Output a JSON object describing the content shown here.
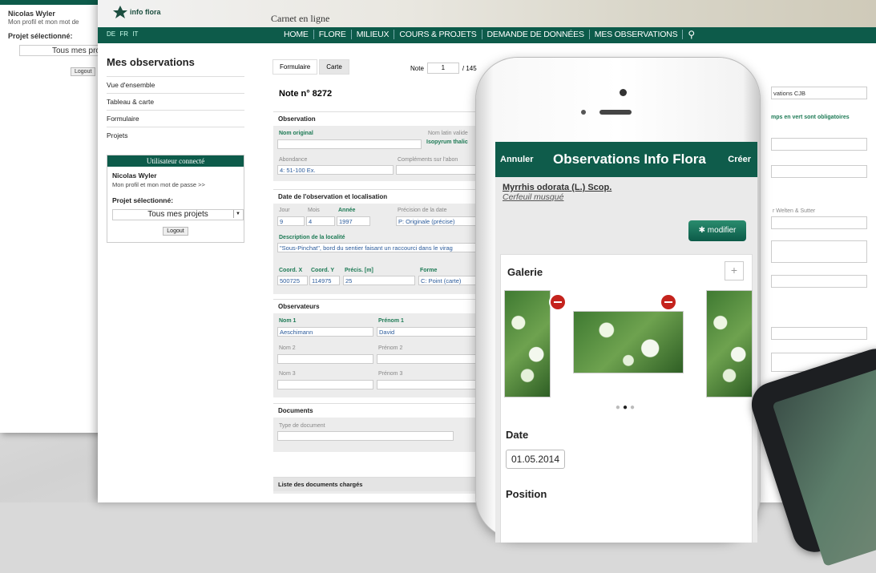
{
  "back_window": {
    "user_name": "Nicolas Wyler",
    "profile_link": "Mon profil et mon mot de",
    "project_label": "Projet sélectionné:",
    "project_value": "Tous mes pro",
    "logout": "Logout"
  },
  "header": {
    "logo_text": "info flora",
    "carnet": "Carnet en ligne",
    "languages": "DE  FR  IT",
    "menu": [
      "HOME",
      "FLORE",
      "MILIEUX",
      "COURS & PROJETS",
      "DEMANDE DE DONNÉES",
      "MES OBSERVATIONS"
    ]
  },
  "sidebar": {
    "title": "Mes observations",
    "items": [
      "Vue d'ensemble",
      "Tableau & carte",
      "Formulaire",
      "Projets"
    ],
    "user_box": {
      "title": "Utilisateur connecté",
      "name": "Nicolas Wyler",
      "profile": "Mon profil et mon mot de passe >>",
      "project_label": "Projet sélectionné:",
      "project_value": "Tous mes projets",
      "logout": "Logout"
    }
  },
  "form": {
    "tabs": [
      "Formulaire",
      "Carte"
    ],
    "note_label": "Note",
    "note_current": "1",
    "note_total": "/ 145",
    "note_title": "Note n° 8272",
    "observation": {
      "title": "Observation",
      "nom_original_label": "Nom original",
      "nom_latin_label": "Nom latin valide",
      "nom_latin_value": "Isopyrum thalic",
      "abondance_label": "Abondance",
      "abondance_value": "4: 51-100 Ex.",
      "complements_label": "Compléments sur l'abon"
    },
    "date_loc": {
      "title": "Date de l'observation et localisation",
      "jour_label": "Jour",
      "jour": "9",
      "mois_label": "Mois",
      "mois": "4",
      "annee_label": "Année",
      "annee": "1997",
      "precision_label": "Précision de la date",
      "precision_value": "P: Originale (précise)",
      "description_label": "Description de la localité",
      "description_value": "\"Sous-Pinchat\", bord du sentier faisant un raccourci dans le virag",
      "x_label": "Coord. X",
      "x": "500725",
      "y_label": "Coord. Y",
      "y": "114975",
      "precis_label": "Précis. [m]",
      "precis": "25",
      "forme_label": "Forme",
      "forme": "C: Point (carte)"
    },
    "observateurs": {
      "title": "Observateurs",
      "nom1_label": "Nom 1",
      "nom1": "Aeschimann",
      "prenom1_label": "Prénom 1",
      "prenom1": "David",
      "nom2_label": "Nom 2",
      "prenom2_label": "Prénom 2",
      "nom3_label": "Nom 3",
      "prenom3_label": "Prénom 3"
    },
    "documents": {
      "title": "Documents",
      "type_label": "Type de document",
      "list_title": "Liste des documents chargés"
    },
    "right": {
      "project_select": "vations CJB",
      "required_note": "mps en vert sont obligatoires",
      "weiten": "r Welten & Sutter"
    }
  },
  "phone": {
    "cancel": "Annuler",
    "title": "Observations Info Flora",
    "create": "Créer",
    "species_latin": "Myrrhis odorata (L.) Scop.",
    "species_common": "Cerfeuil musqué",
    "modify": "modifier",
    "gallery_title": "Galerie",
    "date_title": "Date",
    "date_value": "01.05.2014",
    "position_title": "Position"
  }
}
